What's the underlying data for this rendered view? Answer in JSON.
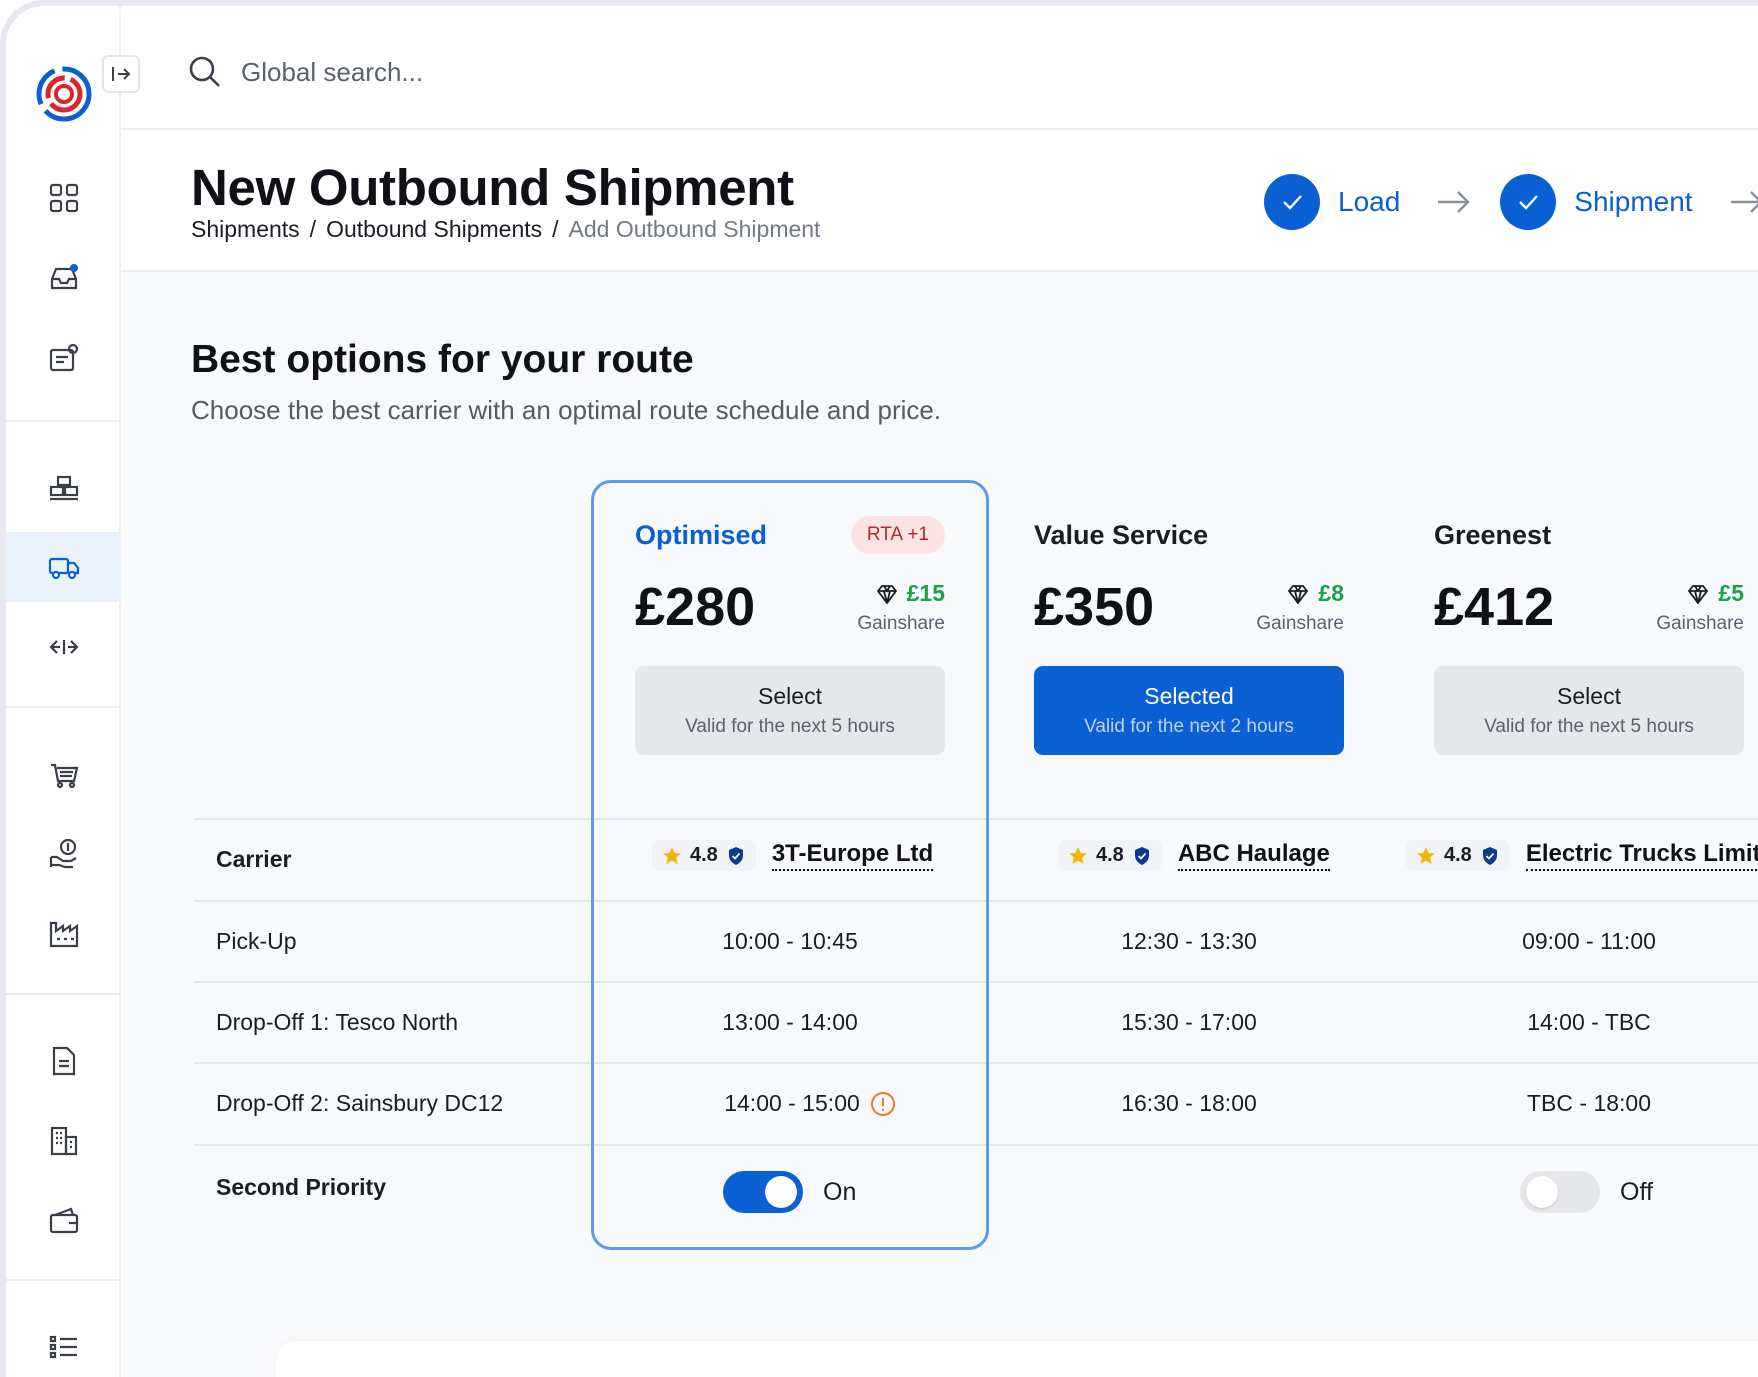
{
  "search": {
    "placeholder": "Global search..."
  },
  "header": {
    "title": "New Outbound Shipment",
    "breadcrumb": [
      "Shipments",
      "Outbound Shipments",
      "Add Outbound Shipment"
    ],
    "breadcrumb_sep": "/"
  },
  "stepper": {
    "steps": [
      {
        "label": "Load",
        "done": true
      },
      {
        "label": "Shipment",
        "done": true
      }
    ]
  },
  "section": {
    "title": "Best options for your route",
    "subtitle": "Choose the best carrier with an optimal route schedule and price."
  },
  "options": [
    {
      "name": "Optimised",
      "badge": "RTA +1",
      "price": "£280",
      "gainshare": "£15",
      "gainshare_label": "Gainshare",
      "button": "Select",
      "validity": "Valid for the next 5 hours",
      "selected": false,
      "rating": "4.8",
      "carrier": "3T-Europe Ltd",
      "pickup": "10:00 - 10:45",
      "dropoff1": "13:00 - 14:00",
      "dropoff2": "14:00 - 15:00",
      "second_priority": "On"
    },
    {
      "name": "Value Service",
      "price": "£350",
      "gainshare": "£8",
      "gainshare_label": "Gainshare",
      "button": "Selected",
      "validity": "Valid for the next 2 hours",
      "selected": true,
      "rating": "4.8",
      "carrier": "ABC Haulage",
      "pickup": "12:30 - 13:30",
      "dropoff1": "15:30 - 17:00",
      "dropoff2": "16:30 - 18:00"
    },
    {
      "name": "Greenest",
      "price": "£412",
      "gainshare": "£5",
      "gainshare_label": "Gainshare",
      "button": "Select",
      "validity": "Valid for the next 5 hours",
      "selected": false,
      "rating": "4.8",
      "carrier": "Electric Trucks Limited",
      "pickup": "09:00 - 11:00",
      "dropoff1": "14:00 - TBC",
      "dropoff2": "TBC - 18:00",
      "second_priority": "Off"
    }
  ],
  "rows": {
    "carrier": "Carrier",
    "pickup": "Pick-Up",
    "dropoff1": "Drop-Off 1: Tesco North",
    "dropoff2": "Drop-Off 2: Sainsbury DC12",
    "second_priority": "Second Priority"
  },
  "colors": {
    "accent": "#0a5fd3",
    "gainshare": "#17a34a",
    "badge_bg": "#fde4e4",
    "badge_text": "#b8262c",
    "warning": "#e8772e"
  },
  "icons": [
    "dashboard-icon",
    "inbox-icon",
    "orders-icon",
    "warehouse-icon",
    "truck-icon",
    "transfer-icon",
    "cart-icon",
    "finance-icon",
    "factory-icon",
    "document-icon",
    "building-icon",
    "wallet-icon",
    "list-icon"
  ]
}
